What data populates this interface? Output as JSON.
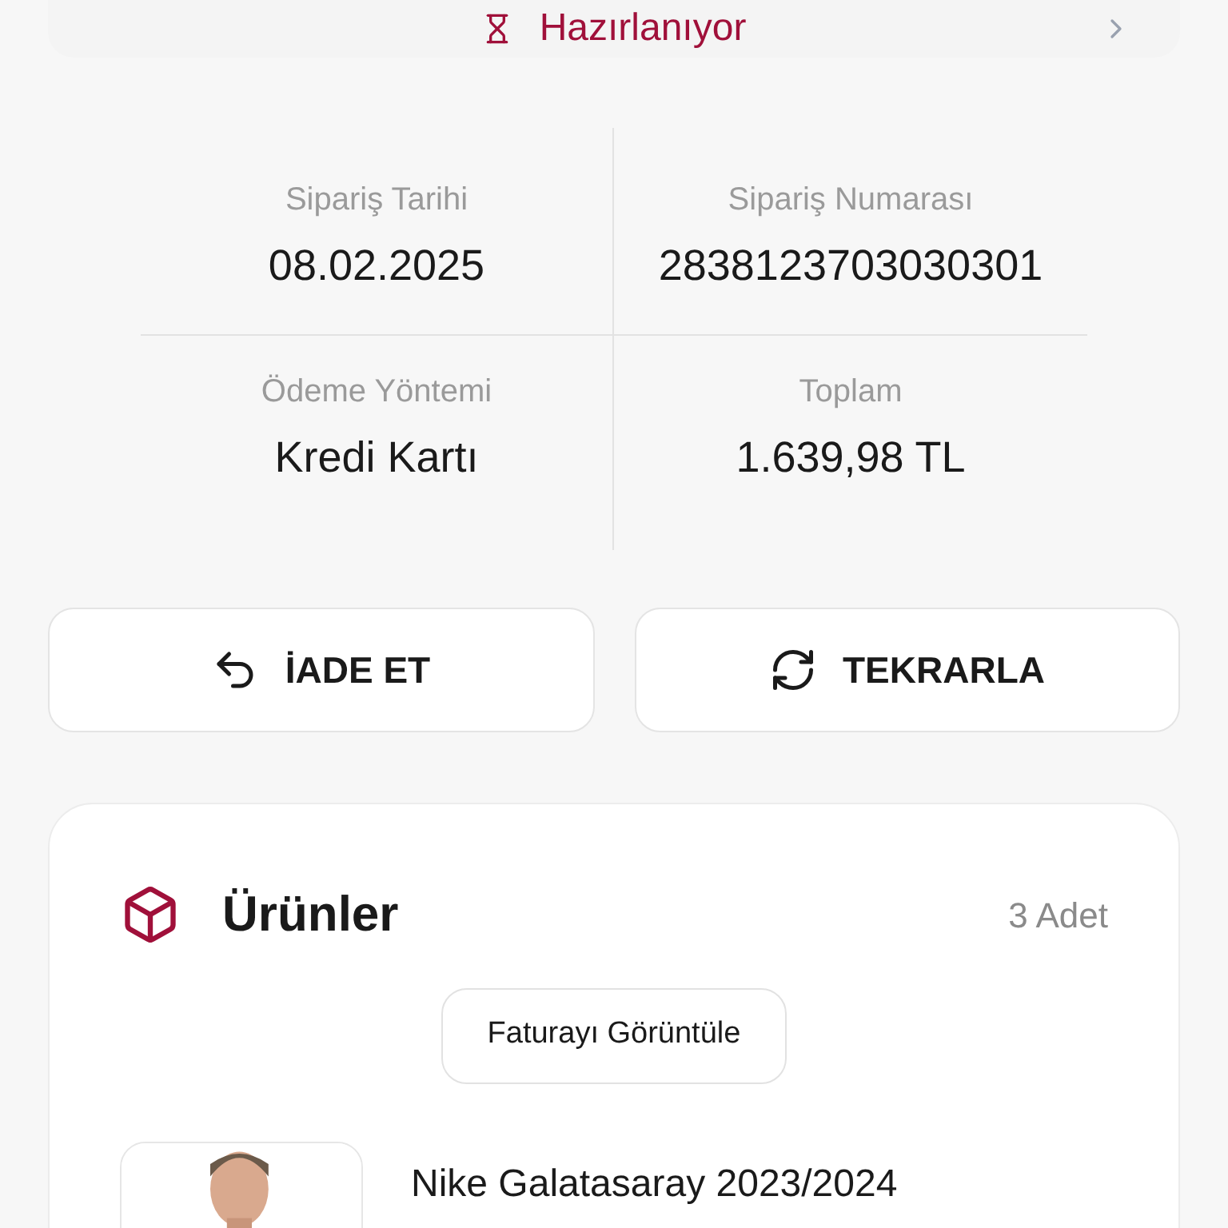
{
  "status": {
    "label": "Hazırlanıyor"
  },
  "summary": [
    {
      "label": "Sipariş Tarihi",
      "value": "08.02.2025"
    },
    {
      "label": "Sipariş Numarası",
      "value": "2838123703030301"
    },
    {
      "label": "Ödeme Yöntemi",
      "value": "Kredi Kartı"
    },
    {
      "label": "Toplam",
      "value": "1.639,98 TL"
    }
  ],
  "actions": [
    {
      "kind": "return",
      "label": "İADE ET"
    },
    {
      "kind": "repeat",
      "label": "TEKRARLA"
    }
  ],
  "products": {
    "title": "Ürünler",
    "count": "3 Adet",
    "invoice_button": "Faturayı Görüntüle",
    "items": [
      {
        "name": "Nike Galatasaray 2023/2024"
      }
    ]
  }
}
